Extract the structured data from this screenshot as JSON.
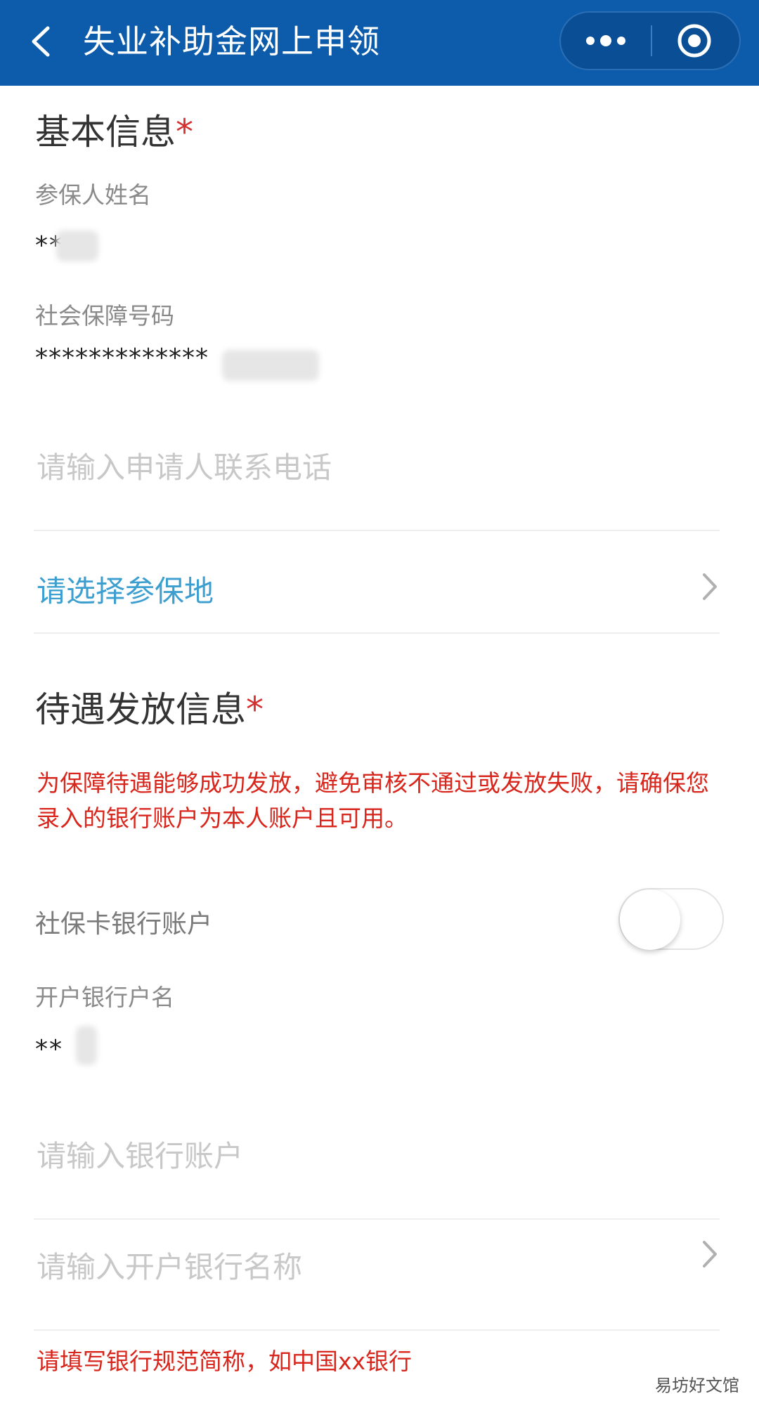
{
  "nav": {
    "title": "失业补助金网上申领",
    "icons": {
      "back": "chevron-left-icon",
      "more": "more-dots-icon",
      "close": "target-close-icon"
    }
  },
  "basic": {
    "heading": "基本信息",
    "required_mark": "*",
    "name_label": "参保人姓名",
    "name_value": "**",
    "ssn_label": "社会保障号码",
    "ssn_value": "*************",
    "phone_placeholder": "请输入申请人联系电话",
    "region_placeholder": "请选择参保地"
  },
  "payment": {
    "heading": "待遇发放信息",
    "required_mark": "*",
    "warning": "为保障待遇能够成功发放，避免审核不通过或发放失败，请确保您录入的银行账户为本人账户且可用。",
    "card_toggle_label": "社保卡银行账户",
    "card_toggle_on": false,
    "account_name_label": "开户银行户名",
    "account_name_value": "**",
    "account_placeholder": "请输入银行账户",
    "bank_name_placeholder": "请输入开户银行名称",
    "bank_hint": "请填写银行规范简称，如中国xx银行"
  },
  "watermark": "易坊好文馆",
  "colors": {
    "nav_bg": "#0d5cab",
    "required": "#d43030",
    "warning": "#d8261c",
    "link": "#3d9fd0",
    "placeholder": "#c8c8c8"
  }
}
